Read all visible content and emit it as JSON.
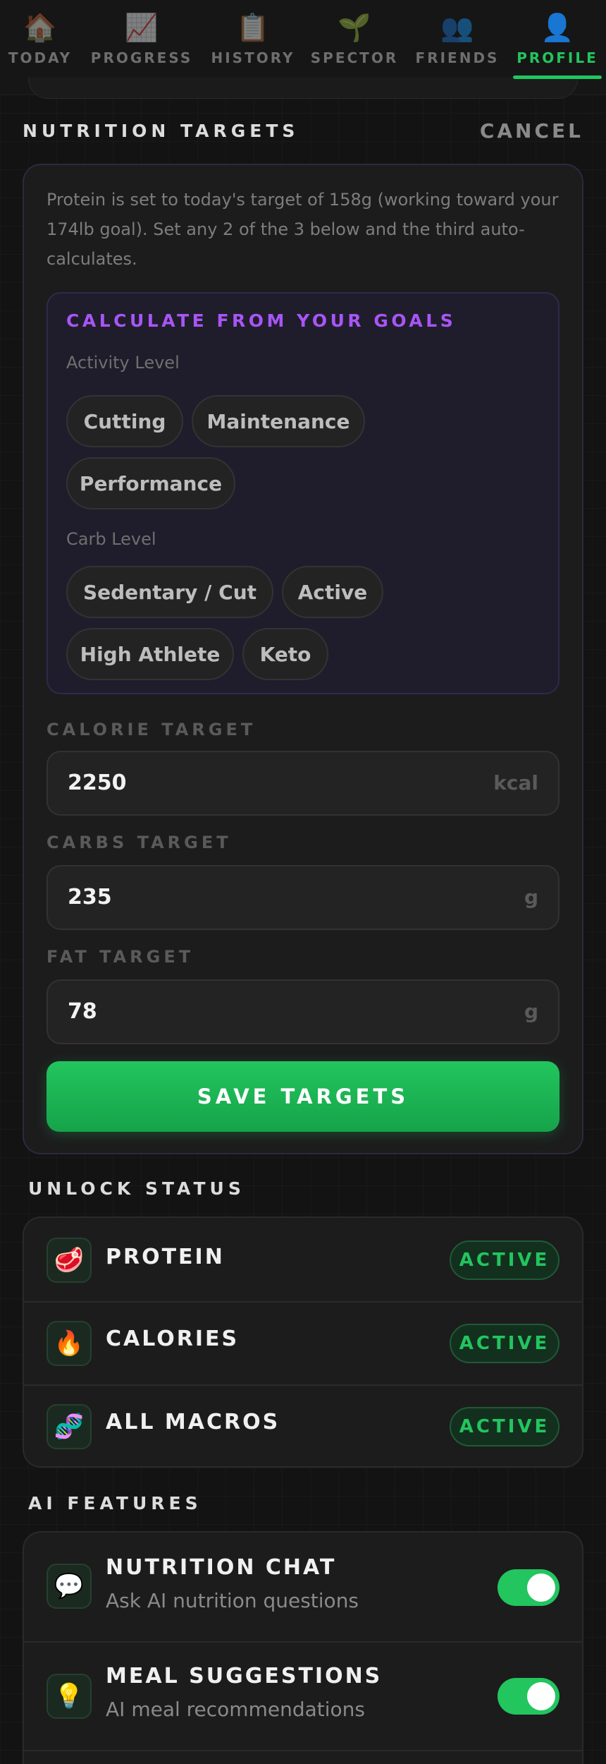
{
  "nav": {
    "tabs": [
      {
        "label": "TODAY",
        "icon": "🏠"
      },
      {
        "label": "PROGRESS",
        "icon": "📈"
      },
      {
        "label": "HISTORY",
        "icon": "📋"
      },
      {
        "label": "SPECTOR",
        "icon": "🌱"
      },
      {
        "label": "FRIENDS",
        "icon": "👥"
      },
      {
        "label": "PROFILE",
        "icon": "👤"
      }
    ],
    "active": "PROFILE"
  },
  "nutrition": {
    "title": "NUTRITION TARGETS",
    "cancel": "CANCEL",
    "intro": "Protein is set to today's target of 158g (working toward your 174lb goal). Set any 2 of the 3 below and the third auto-calculates.",
    "calc": {
      "title": "CALCULATE FROM YOUR GOALS",
      "activity_label": "Activity Level",
      "activity_options": [
        "Cutting",
        "Maintenance",
        "Performance"
      ],
      "carb_label": "Carb Level",
      "carb_options": [
        "Sedentary / Cut",
        "Active",
        "High Athlete",
        "Keto"
      ]
    },
    "fields": [
      {
        "label": "CALORIE TARGET",
        "value": "2250",
        "unit": "kcal"
      },
      {
        "label": "CARBS TARGET",
        "value": "235",
        "unit": "g"
      },
      {
        "label": "FAT TARGET",
        "value": "78",
        "unit": "g"
      }
    ],
    "save": "SAVE TARGETS"
  },
  "unlock": {
    "title": "UNLOCK STATUS",
    "items": [
      {
        "icon": "🥩",
        "label": "PROTEIN",
        "status": "ACTIVE"
      },
      {
        "icon": "🔥",
        "label": "CALORIES",
        "status": "ACTIVE"
      },
      {
        "icon": "🧬",
        "label": "ALL MACROS",
        "status": "ACTIVE"
      }
    ]
  },
  "ai": {
    "title": "AI FEATURES",
    "items": [
      {
        "icon": "💬",
        "label": "NUTRITION CHAT",
        "sub": "Ask AI nutrition questions",
        "enabled": true
      },
      {
        "icon": "💡",
        "label": "MEAL SUGGESTIONS",
        "sub": "AI meal recommendations",
        "enabled": true
      }
    ]
  },
  "colors": {
    "accent": "#22c55e",
    "purple": "#a855f7",
    "background": "#131313"
  }
}
